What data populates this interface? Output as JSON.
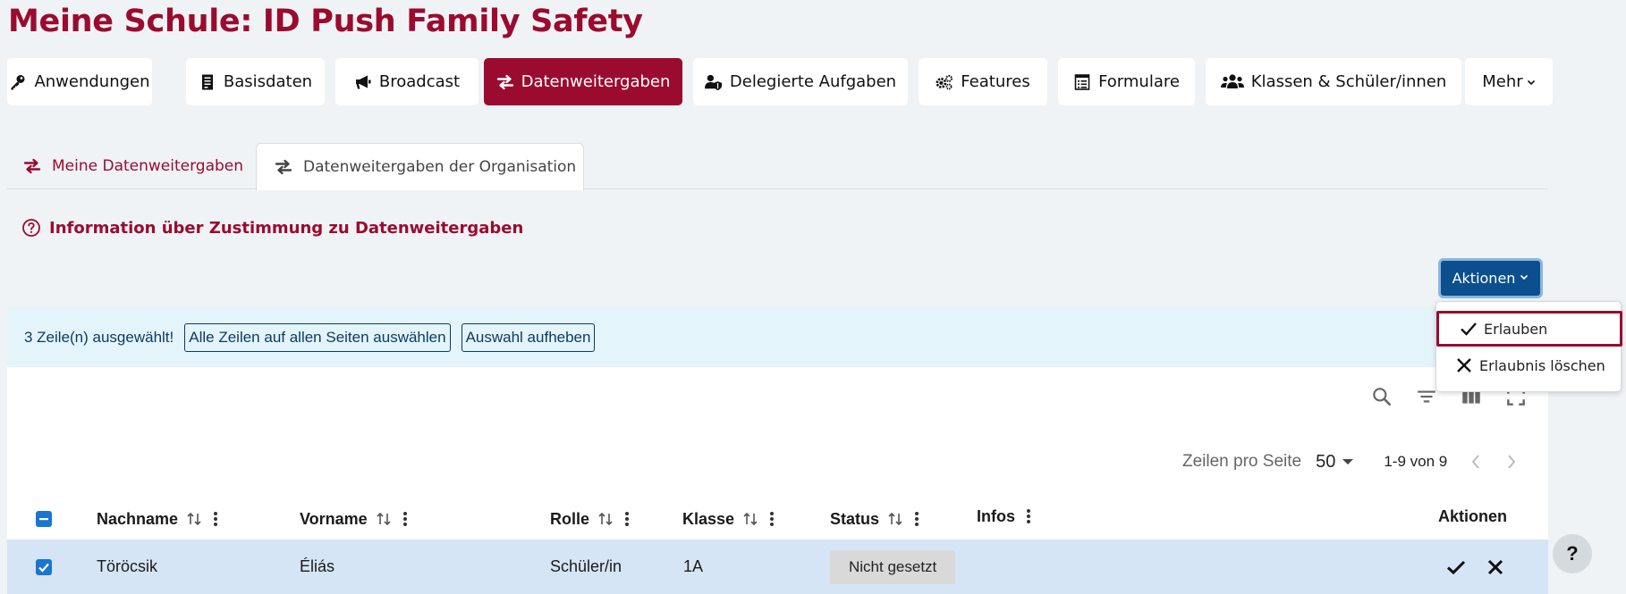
{
  "page": {
    "title": "Meine Schule: ID Push Family Safety"
  },
  "nav": {
    "items": [
      {
        "label": "Anwendungen",
        "icon": "key-icon"
      },
      {
        "label": "Basisdaten",
        "icon": "document-list-icon"
      },
      {
        "label": "Broadcast",
        "icon": "megaphone-icon"
      },
      {
        "label": "Datenweitergaben",
        "icon": "exchange-arrows-icon",
        "active": true
      },
      {
        "label": "Delegierte Aufgaben",
        "icon": "user-shield-icon"
      },
      {
        "label": "Features",
        "icon": "gears-icon"
      },
      {
        "label": "Formulare",
        "icon": "form-icon"
      },
      {
        "label": "Klassen & Schüler/innen",
        "icon": "users-icon"
      }
    ],
    "more_label": "Mehr"
  },
  "subtabs": {
    "mine": "Meine Datenweitergaben",
    "org": "Datenweitergaben der Organisation"
  },
  "info_link": "Information über Zustimmung zu Datenweitergaben",
  "actions_button": "Aktionen",
  "dropdown": {
    "allow": "Erlauben",
    "delete_permission": "Erlaubnis löschen"
  },
  "selection": {
    "text": "3 Zeile(n) ausgewählt!",
    "select_all": "Alle Zeilen auf allen Seiten auswählen",
    "clear": "Auswahl aufheben"
  },
  "pager": {
    "rows_per_page_label": "Zeilen pro Seite",
    "rows_per_page": "50",
    "range": "1-9 von 9"
  },
  "table": {
    "headers": {
      "lastname": "Nachname",
      "firstname": "Vorname",
      "role": "Rolle",
      "class": "Klasse",
      "status": "Status",
      "info": "Infos",
      "actions": "Aktionen"
    },
    "rows": [
      {
        "lastname": "Töröcsik",
        "firstname": "Éliás",
        "role": "Schüler/in",
        "class": "1A",
        "status": "Nicht gesetzt"
      }
    ]
  },
  "help": {
    "label": "?"
  },
  "colors": {
    "brand": "#9b0b2f",
    "primary": "#0b4f8e",
    "selection_bg": "#e3f4fb",
    "row_selected": "#d5e5f5"
  }
}
